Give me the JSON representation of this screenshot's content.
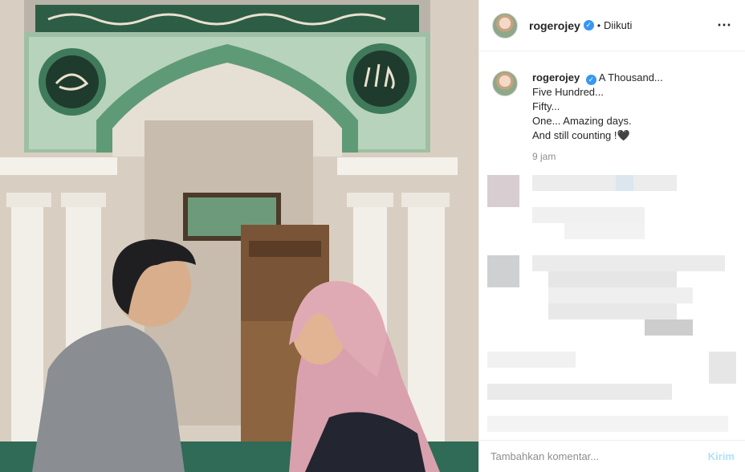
{
  "header": {
    "username": "rogerojey",
    "separator": "•",
    "follow_status": "Diikuti",
    "more_icon": "more-horizontal-icon"
  },
  "caption": {
    "username": "rogerojey",
    "lines": [
      "A Thousand...",
      "Five Hundred...",
      "Fifty...",
      "One... Amazing days.",
      "And still counting !🖤"
    ]
  },
  "post_time": "9 jam",
  "comment_box": {
    "placeholder": "Tambahkan komentar...",
    "send_label": "Kirim"
  },
  "colors": {
    "verified": "#3897f0",
    "send_disabled": "#b2dffc",
    "muted": "#8e8e8e"
  }
}
